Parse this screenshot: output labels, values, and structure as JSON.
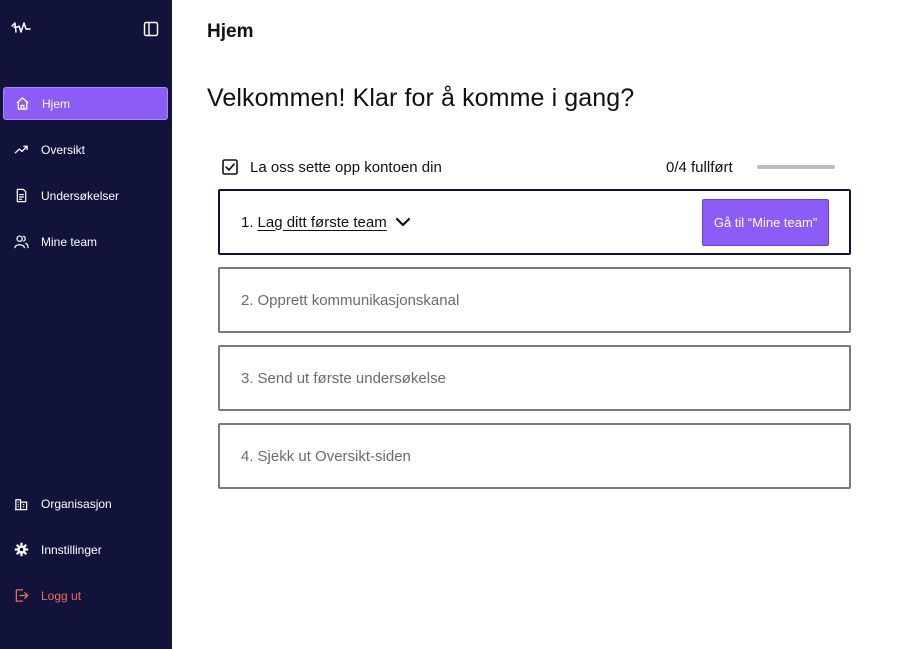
{
  "sidebar": {
    "logo_icon": "pulse-logo-icon",
    "collapse_icon": "sidebar-toggle-icon",
    "nav_items": [
      {
        "label": "Hjem",
        "icon": "home-icon",
        "active": true
      },
      {
        "label": "Oversikt",
        "icon": "trend-icon"
      },
      {
        "label": "Undersøkelser",
        "icon": "document-icon"
      },
      {
        "label": "Mine team",
        "icon": "users-icon"
      }
    ],
    "bottom_items": [
      {
        "label": "Organisasjon",
        "icon": "building-icon"
      },
      {
        "label": "Innstillinger",
        "icon": "gear-icon"
      },
      {
        "label": "Logg ut",
        "icon": "logout-icon",
        "color": "#f26a5f"
      }
    ]
  },
  "main": {
    "page_title": "Hjem",
    "welcome": "Velkommen! Klar for å komme i gang?",
    "setup": {
      "label": "La oss sette opp kontoen din",
      "progress_text": "0/4 fullført",
      "progress_fraction": 0
    },
    "steps": [
      {
        "number": "1.",
        "title": "Lag ditt første team",
        "expanded": true,
        "button_label": "Gå til “Mine team”"
      },
      {
        "number": "2.",
        "title": "Opprett kommunikasjonskanal"
      },
      {
        "number": "3.",
        "title": "Send ut første undersøkelse"
      },
      {
        "number": "4.",
        "title": "Sjekk ut Oversikt-siden"
      }
    ]
  },
  "colors": {
    "sidebar_bg": "#12133b",
    "accent": "#8b5cf6",
    "logout": "#f26a5f"
  }
}
